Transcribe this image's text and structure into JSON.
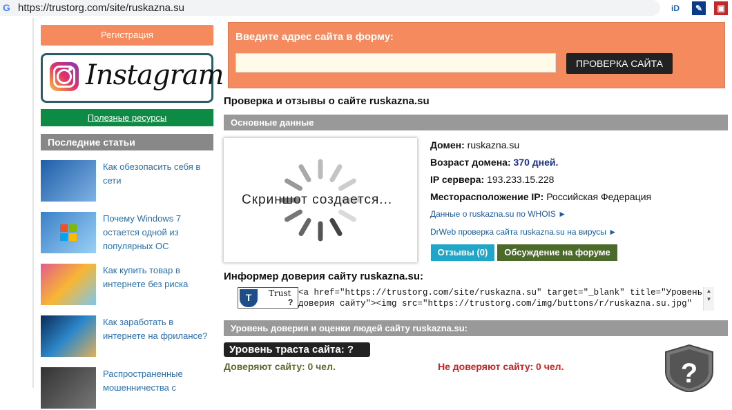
{
  "browser": {
    "url": "https://trustorg.com/site/ruskazna.su",
    "google_icon": "G",
    "extensions": [
      {
        "name": "id-extension-icon",
        "glyph": "iD"
      },
      {
        "name": "pen-extension-icon",
        "glyph": "✎"
      },
      {
        "name": "gift-extension-icon",
        "glyph": "▣"
      }
    ]
  },
  "sidebar": {
    "register_label": "Регистрация",
    "instagram_word": "Instagram",
    "useful_label": "Полезные ресурсы",
    "latest_heading": "Последние статьи",
    "articles": [
      {
        "title": "Как обезопасить себя в сети"
      },
      {
        "title": "Почему Windows 7 остается одной из популярных ОС"
      },
      {
        "title": "Как купить товар в интернете без риска"
      },
      {
        "title": "Как заработать в интернете на фрилансе?"
      },
      {
        "title": "Распространенные мошенничества с"
      }
    ]
  },
  "form": {
    "label": "Введите адрес сайта в форму:",
    "input_value": "",
    "button_label": "ПРОВЕРКА САЙТА"
  },
  "page": {
    "title": "Проверка и отзывы о сайте ruskazna.su",
    "main_section": "Основные данные",
    "screenshot_caption": "Скриншот создается...",
    "domain_label": "Домен:",
    "domain_value": "ruskazna.su",
    "age_label": "Возраст домена:",
    "age_value": "370 дней.",
    "ip_label": "IP сервера:",
    "ip_value": "193.233.15.228",
    "location_label": "Месторасположение IP:",
    "location_value": "Российская Федерация",
    "whois_link": "Данные о ruskazna.su по WHOIS ►",
    "drweb_link": "DrWeb проверка сайта ruskazna.su на вирусы ►",
    "reviews_button": "Отзывы (0)",
    "forum_button": "Обсуждение на форуме",
    "informer_title": "Информер доверия сайту ruskazna.su:",
    "badge_word": "Trust",
    "badge_mark": "?",
    "code_line1": "<a href=\"https://trustorg.com/site/ruskazna.su\" target=\"_blank\" title=\"Уровень",
    "code_line2": "доверия сайту\"><img src=\"https://trustorg.com/img/buttons/r/ruskazna.su.jpg\"",
    "trust_section": "Уровень доверия и оценки людей сайту ruskazna.su:",
    "trust_level": "Уровень траста сайта: ?",
    "trust_yes": "Доверяют сайту: 0 чел.",
    "trust_no": "Не доверяют сайту: 0 чел."
  },
  "colors": {
    "accent_orange": "#f58a5e",
    "green": "#0d8a43",
    "link_blue": "#2a6fb0",
    "red": "#d42020"
  }
}
